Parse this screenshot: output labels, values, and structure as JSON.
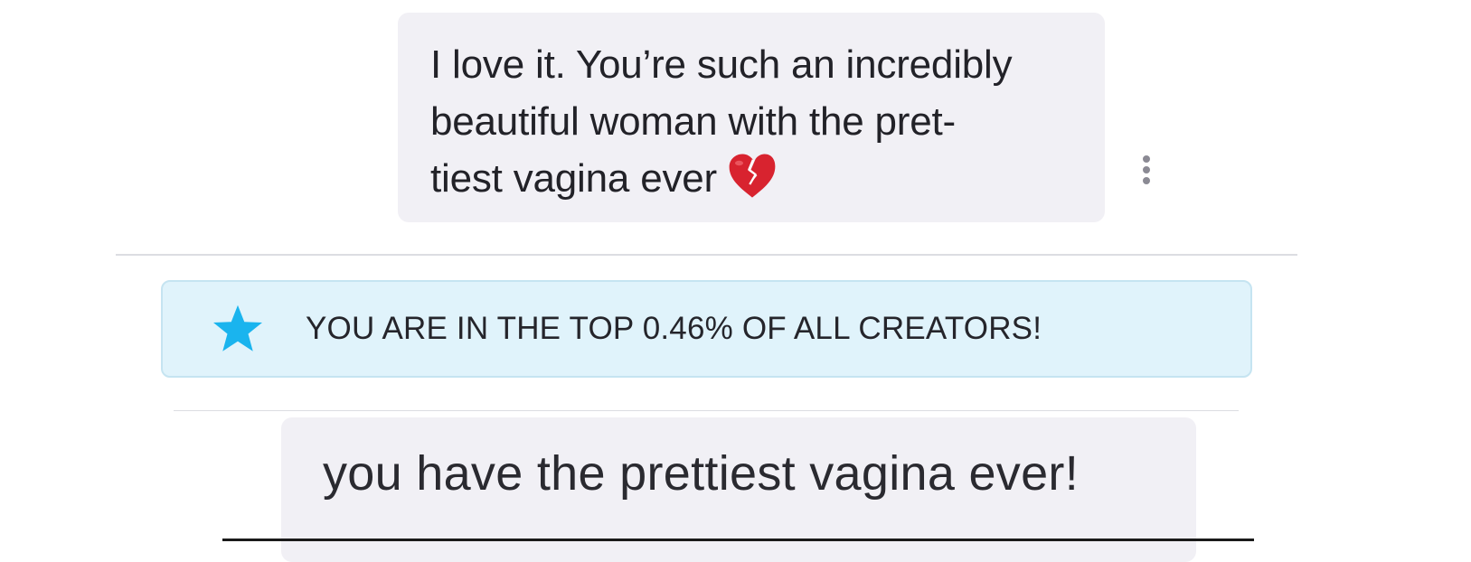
{
  "messages": [
    {
      "text": "I love it. You’re such an incredibly beautiful woman with the pret-tiest vagina ever",
      "lines": [
        "I love it. You’re such an incredibly",
        "beautiful woman with the pret-",
        "tiest vagina ever"
      ],
      "emoji": "broken-heart-emoji"
    },
    {
      "text": "you have the prettiest vagina ever!",
      "lines": [
        "you have the prettiest vagina ever!"
      ]
    }
  ],
  "banner": {
    "icon": "star-icon",
    "text": "YOU ARE IN THE TOP 0.46% OF ALL CREATORS!",
    "accent_color": "#1ab4ee",
    "background_color": "#e0f3fb"
  },
  "message_menu": {
    "icon": "more-vertical-icon"
  },
  "colors": {
    "bubble_background": "#f1f0f5",
    "text": "#222228"
  }
}
